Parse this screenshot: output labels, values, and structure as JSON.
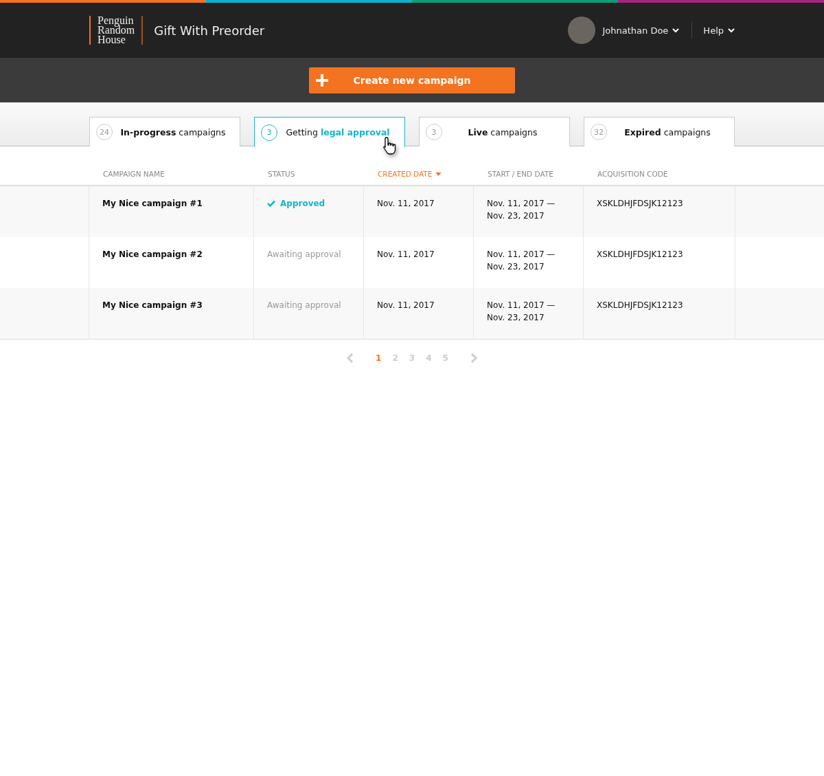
{
  "header": {
    "logo": [
      "Penguin",
      "Random",
      "House"
    ],
    "app_title": "Gift With Preorder",
    "user": {
      "name": "Johnathan Doe"
    },
    "help": "Help"
  },
  "create_button": {
    "label": "Create new campaign"
  },
  "tabs": [
    {
      "count": "24",
      "label": "**In-progress** campaigns",
      "selected": false
    },
    {
      "count": "3",
      "label": "Getting **legal approval**",
      "selected": true
    },
    {
      "count": "3",
      "label": "**Live** campaigns",
      "selected": false
    },
    {
      "count": "32",
      "label": "**Expired** campaigns",
      "selected": false
    }
  ],
  "table": {
    "columns": [
      {
        "label": "CAMPAIGN NAME",
        "sorted": false
      },
      {
        "label": "STATUS",
        "sorted": false
      },
      {
        "label": "CREATED DATE",
        "sorted": true
      },
      {
        "label": "START / END DATE",
        "sorted": false
      },
      {
        "label": "ACQUISITION CODE",
        "sorted": false
      }
    ],
    "rows": [
      {
        "name": "My Nice campaign #1",
        "status": {
          "kind": "approved",
          "text": "Approved"
        },
        "created": "Nov. 11, 2017",
        "start": "Nov. 11, 2017 —",
        "end": "Nov. 23, 2017",
        "code": "XSKLDHJFDSJK12123"
      },
      {
        "name": "My Nice campaign #2",
        "status": {
          "kind": "awaiting",
          "text": "Awaiting approval"
        },
        "created": "Nov. 11, 2017",
        "start": "Nov. 11, 2017 —",
        "end": "Nov. 23, 2017",
        "code": "XSKLDHJFDSJK12123"
      },
      {
        "name": "My Nice campaign #3",
        "status": {
          "kind": "awaiting",
          "text": "Awaiting approval"
        },
        "created": "Nov. 11, 2017",
        "start": "Nov. 11, 2017 —",
        "end": "Nov. 23, 2017",
        "code": "XSKLDHJFDSJK12123"
      }
    ]
  },
  "pagination": {
    "pages": [
      {
        "label": "1",
        "selected": true
      },
      {
        "label": "2",
        "selected": false
      },
      {
        "label": "3",
        "selected": false
      },
      {
        "label": "4",
        "selected": false
      },
      {
        "label": "5",
        "selected": false
      }
    ]
  }
}
